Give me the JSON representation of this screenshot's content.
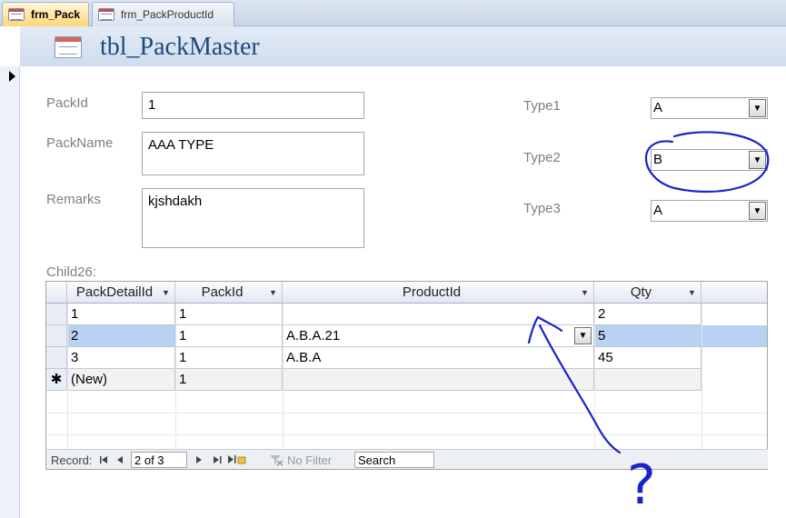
{
  "tabs": [
    {
      "label": "frm_Pack",
      "active": true
    },
    {
      "label": "frm_PackProductId",
      "active": false
    }
  ],
  "header": {
    "title": "tbl_PackMaster"
  },
  "form": {
    "packid": {
      "label": "PackId",
      "value": "1"
    },
    "packname": {
      "label": "PackName",
      "value": "AAA TYPE"
    },
    "remarks": {
      "label": "Remarks",
      "value": "kjshdakh"
    },
    "type1": {
      "label": "Type1",
      "value": "A"
    },
    "type2": {
      "label": "Type2",
      "value": "B"
    },
    "type3": {
      "label": "Type3",
      "value": "A"
    }
  },
  "subform": {
    "label": "Child26:",
    "columns": [
      "PackDetailId",
      "PackId",
      "ProductId",
      "Qty"
    ],
    "rows": [
      {
        "detail": "1",
        "pack": "1",
        "product": "",
        "qty": "2"
      },
      {
        "detail": "2",
        "pack": "1",
        "product": "A.B.A.21",
        "qty": "5"
      },
      {
        "detail": "3",
        "pack": "1",
        "product": "A.B.A",
        "qty": "45"
      },
      {
        "detail": "(New)",
        "pack": "1",
        "product": "",
        "qty": ""
      }
    ],
    "new_row_marker": "✱"
  },
  "navigation": {
    "record_label": "Record:",
    "position": "2 of 3",
    "filter_label": "No Filter",
    "search_placeholder": "Search"
  },
  "annotation": {
    "symbol": "?"
  },
  "colors": {
    "accent": "#1f497d",
    "selected_row": "#b9d1f2",
    "ink": "#1a23c8"
  }
}
